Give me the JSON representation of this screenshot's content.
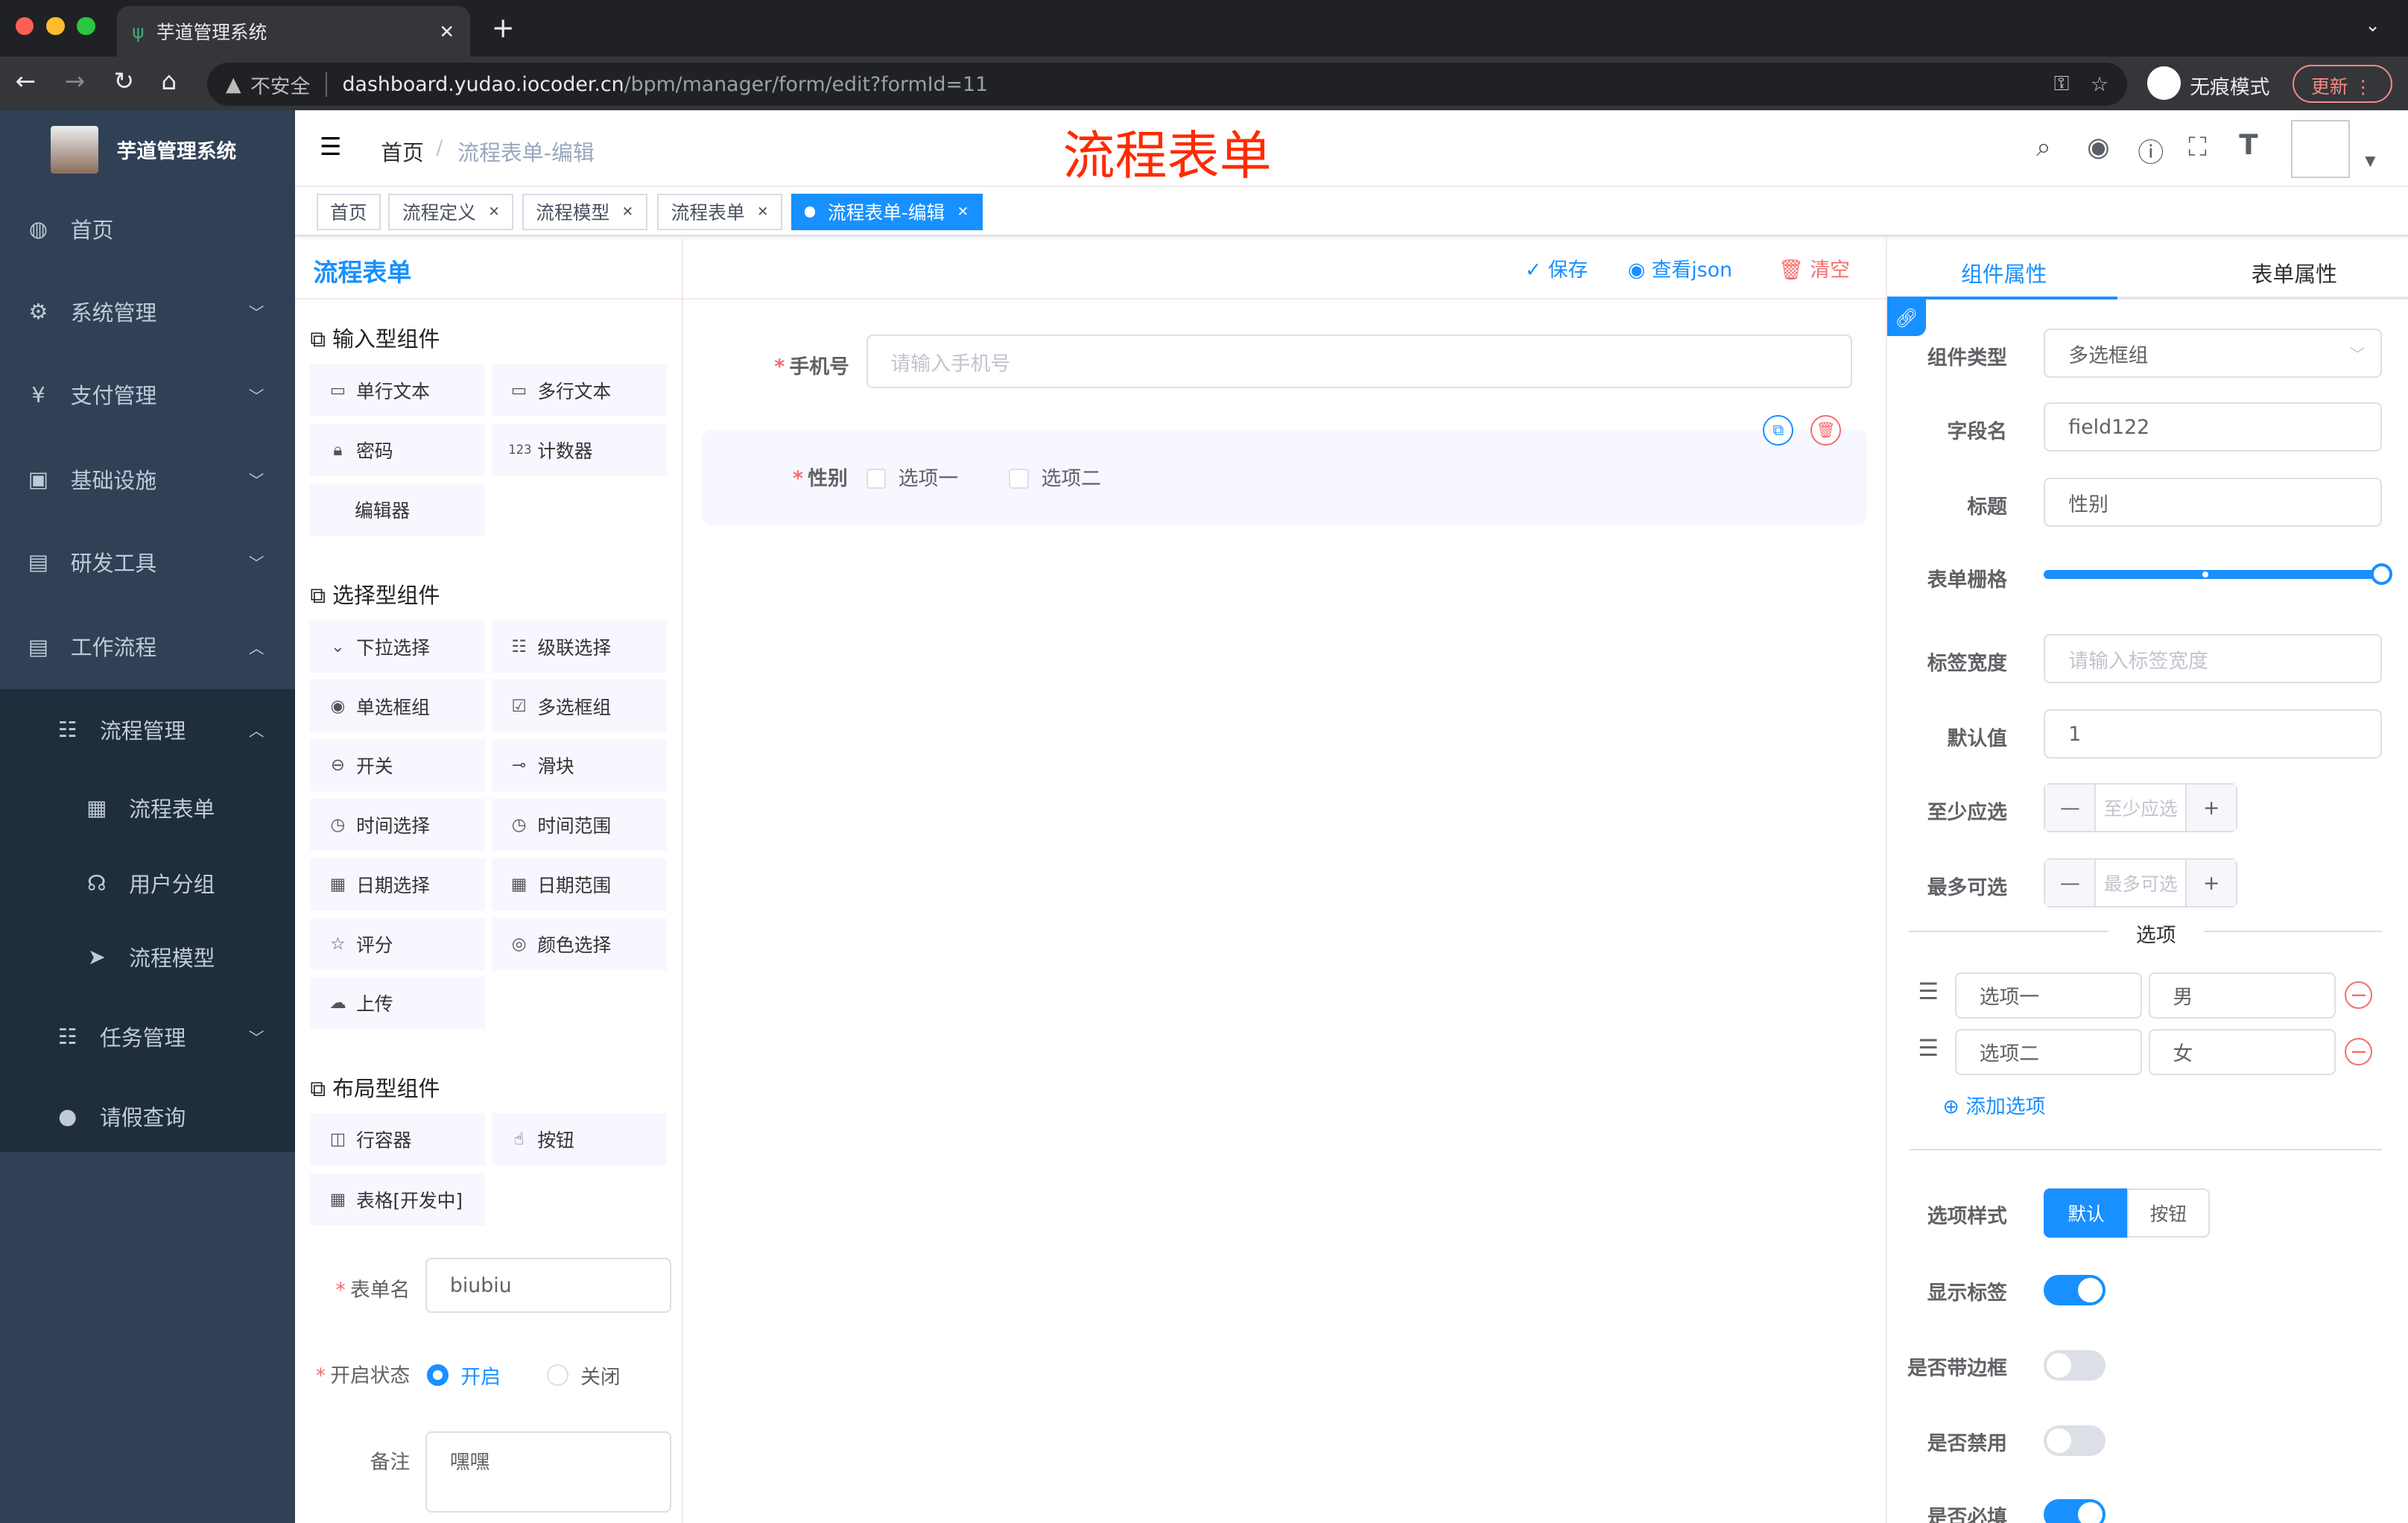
{
  "browser": {
    "tab_title": "芋道管理系统",
    "insecure": "不安全",
    "url_host": "dashboard.yudao.iocoder.cn",
    "url_path": "/bpm/manager/form/edit?formId=11",
    "incognito": "无痕模式",
    "update": "更新"
  },
  "sidebar": {
    "logo_title": "芋道管理系统",
    "items": [
      {
        "label": "首页",
        "icon": "dashboard-icon"
      },
      {
        "label": "系统管理",
        "icon": "gear-icon"
      },
      {
        "label": "支付管理",
        "icon": "yen-icon"
      },
      {
        "label": "基础设施",
        "icon": "monitor-icon"
      },
      {
        "label": "研发工具",
        "icon": "toolbox-icon"
      },
      {
        "label": "工作流程",
        "icon": "toolbox-icon"
      },
      {
        "label": "流程管理",
        "icon": "tree-icon"
      },
      {
        "label": "流程表单",
        "icon": "form-icon"
      },
      {
        "label": "用户分组",
        "icon": "group-icon"
      },
      {
        "label": "流程模型",
        "icon": "send-icon"
      },
      {
        "label": "任务管理",
        "icon": "tree-icon"
      },
      {
        "label": "请假查询",
        "icon": "user-icon"
      }
    ]
  },
  "header": {
    "breadcrumb_home": "首页",
    "breadcrumb_current": "流程表单-编辑",
    "page_overlay_title": "流程表单"
  },
  "tags": [
    "首页",
    "流程定义",
    "流程模型",
    "流程表单",
    "流程表单-编辑"
  ],
  "left": {
    "title": "流程表单",
    "sections": {
      "input": "输入型组件",
      "select": "选择型组件",
      "layout": "布局型组件"
    },
    "input_components": [
      "单行文本",
      "多行文本",
      "密码",
      "计数器",
      "编辑器"
    ],
    "select_components": [
      "下拉选择",
      "级联选择",
      "单选框组",
      "多选框组",
      "开关",
      "滑块",
      "时间选择",
      "时间范围",
      "日期选择",
      "日期范围",
      "评分",
      "颜色选择",
      "上传"
    ],
    "layout_components": [
      "行容器",
      "按钮",
      "表格[开发中]"
    ],
    "form_name_label": "表单名",
    "form_name_value": "biubiu",
    "status_label": "开启状态",
    "status_on": "开启",
    "status_off": "关闭",
    "remark_label": "备注",
    "remark_value": "嘿嘿"
  },
  "toolbar": {
    "save": "保存",
    "view_json": "查看json",
    "clear": "清空"
  },
  "canvas": {
    "phone_label": "手机号",
    "phone_placeholder": "请输入手机号",
    "gender_label": "性别",
    "options": [
      "选项一",
      "选项二"
    ]
  },
  "right": {
    "tabs": [
      "组件属性",
      "表单属性"
    ],
    "component_type_label": "组件类型",
    "component_type_value": "多选框组",
    "field_label": "字段名",
    "field_value": "field122",
    "title_label": "标题",
    "title_value": "性别",
    "grid_label": "表单栅格",
    "grid_value": 24,
    "grid_max": 24,
    "label_width_label": "标签宽度",
    "label_width_placeholder": "请输入标签宽度",
    "default_label": "默认值",
    "default_value": "1",
    "min_label": "至少应选",
    "min_placeholder": "至少应选",
    "max_label": "最多可选",
    "max_placeholder": "最多可选",
    "options_divider": "选项",
    "options": [
      {
        "label": "选项一",
        "value": "男"
      },
      {
        "label": "选项二",
        "value": "女"
      }
    ],
    "add_option": "添加选项",
    "option_style_label": "选项样式",
    "option_style_default": "默认",
    "option_style_button": "按钮",
    "show_label": "显示标签",
    "show_label_on": true,
    "border_label": "是否带边框",
    "border_on": false,
    "disabled_label": "是否禁用",
    "disabled_on": false,
    "required_label": "是否必填",
    "required_on": true
  },
  "colors": {
    "accent": "#1890ff",
    "sidebar": "#304156",
    "danger": "#f56c6c",
    "overlay_title": "#ff2a00"
  }
}
